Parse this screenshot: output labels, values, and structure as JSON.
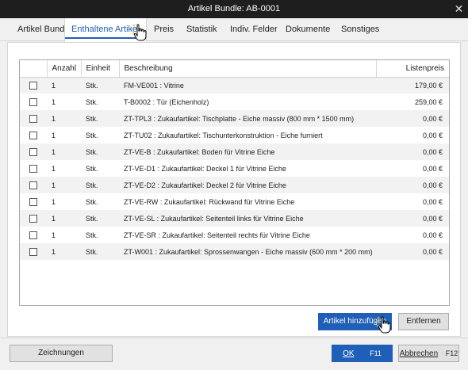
{
  "window": {
    "title": "Artikel Bundle: AB-0001",
    "close_glyph": "✕"
  },
  "tabs": [
    {
      "label": "Artikel Bundle"
    },
    {
      "label": "Enthaltene Artikel"
    },
    {
      "label": "Preis"
    },
    {
      "label": "Statistik"
    },
    {
      "label": "Indiv. Felder"
    },
    {
      "label": "Dokumente"
    },
    {
      "label": "Sonstiges"
    }
  ],
  "grid": {
    "headers": {
      "anzahl": "Anzahl",
      "einheit": "Einheit",
      "beschreibung": "Beschreibung",
      "listenpreis": "Listenpreis"
    },
    "rows": [
      {
        "anzahl": "1",
        "einheit": "Stk.",
        "beschreibung": "FM-VE001 : Vitrine",
        "preis": "179,00 €"
      },
      {
        "anzahl": "1",
        "einheit": "Stk.",
        "beschreibung": "T-B0002 : Tür (Eichenholz)",
        "preis": "259,00 €"
      },
      {
        "anzahl": "1",
        "einheit": "Stk.",
        "beschreibung": "ZT-TPL3 : Zukaufartikel: Tischplatte - Eiche massiv (800 mm * 1500 mm)",
        "preis": "0,00 €"
      },
      {
        "anzahl": "1",
        "einheit": "Stk.",
        "beschreibung": "ZT-TU02 : Zukaufartikel: Tischunterkonstruktion - Eiche furniert",
        "preis": "0,00 €"
      },
      {
        "anzahl": "1",
        "einheit": "Stk.",
        "beschreibung": "ZT-VE-B : Zukaufartikel: Boden für Vitrine Eiche",
        "preis": "0,00 €"
      },
      {
        "anzahl": "1",
        "einheit": "Stk.",
        "beschreibung": "ZT-VE-D1 : Zukaufartikel: Deckel 1 für Vitrine Eiche",
        "preis": "0,00 €"
      },
      {
        "anzahl": "1",
        "einheit": "Stk.",
        "beschreibung": "ZT-VE-D2 : Zukaufartikel: Deckel 2 für Vitrine Eiche",
        "preis": "0,00 €"
      },
      {
        "anzahl": "1",
        "einheit": "Stk.",
        "beschreibung": "ZT-VE-RW : Zukaufartikel: Rückwand für Vitrine Eiche",
        "preis": "0,00 €"
      },
      {
        "anzahl": "1",
        "einheit": "Stk.",
        "beschreibung": "ZT-VE-SL : Zukaufartikel: Seitenteil links für Vitrine Eiche",
        "preis": "0,00 €"
      },
      {
        "anzahl": "1",
        "einheit": "Stk.",
        "beschreibung": "ZT-VE-SR : Zukaufartikel: Seitenteil rechts für Vitrine Eiche",
        "preis": "0,00 €"
      },
      {
        "anzahl": "1",
        "einheit": "Stk.",
        "beschreibung": "ZT-W001 : Zukaufartikel: Sprossenwangen - Eiche massiv (600 mm * 200 mm)",
        "preis": "0,00 €"
      }
    ]
  },
  "actions": {
    "add_label": "Artikel hinzufügen",
    "remove_label": "Entfernen"
  },
  "footer": {
    "drawings_label": "Zeichnungen",
    "ok_label": "OK",
    "ok_key": "F11",
    "cancel_label": "Abbrechen",
    "cancel_key": "F12"
  },
  "colors": {
    "accent": "#1f5fb8",
    "titlebar": "#1e1e1e",
    "row_alt": "#f2f2f2"
  }
}
